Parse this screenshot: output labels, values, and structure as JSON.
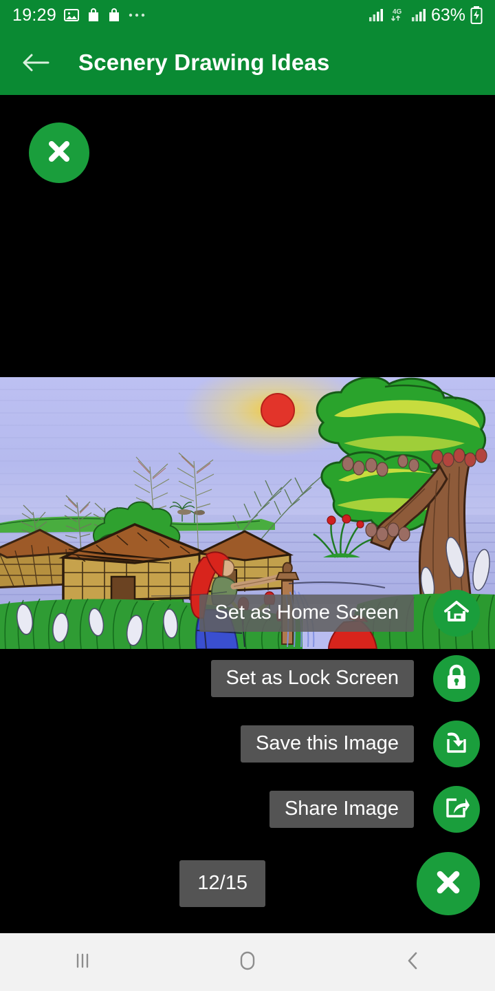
{
  "status_bar": {
    "time": "19:29",
    "battery_text": "63%",
    "network_label": "4G",
    "icons": [
      "gallery-icon",
      "shopping-bag-icon",
      "shopping-bag-icon",
      "overflow-dots-icon",
      "signal-bars-icon",
      "data-transfer-icon",
      "signal-bars-icon",
      "battery-charging-icon"
    ],
    "background_color": "#0a8a33"
  },
  "app_bar": {
    "title": "Scenery Drawing Ideas",
    "back_icon": "back-arrow-icon",
    "background_color": "#0a8a33"
  },
  "viewer": {
    "close_top_icon": "close-x-icon",
    "counter": "12/15",
    "accent_color": "#1a9e3c",
    "pill_color": "#606060"
  },
  "actions": [
    {
      "label": "Set as Home Screen",
      "icon": "home-icon"
    },
    {
      "label": "Set as Lock Screen",
      "icon": "lock-icon"
    },
    {
      "label": "Save this Image",
      "icon": "save-download-icon"
    },
    {
      "label": "Share Image",
      "icon": "share-icon"
    }
  ],
  "artwork": {
    "description": "Crayon scenery drawing: village huts by a lake at sunset with a red sun, a large fruit tree, grass with flowers, and a woman in a red veil at a water pump",
    "sky_color": "#b9bdf0",
    "sun_color": "#e23322",
    "sun_glow_color": "#f3d24a",
    "water_color": "#b0b4e8",
    "grass_color": "#2f9c34",
    "tree_green": "#2aa32c",
    "tree_light_green": "#c3d93c",
    "trunk_color": "#8a5a3c",
    "hut_roof_color": "#a35a2a",
    "hut_wall_color": "#c4a24e",
    "veil_red": "#d8241c",
    "skirt_blue": "#3a4fd0"
  },
  "nav_bar": {
    "recents_icon": "recents-icon",
    "home_icon": "home-nav-icon",
    "back_icon": "back-nav-icon",
    "background_color": "#f2f2f2"
  }
}
